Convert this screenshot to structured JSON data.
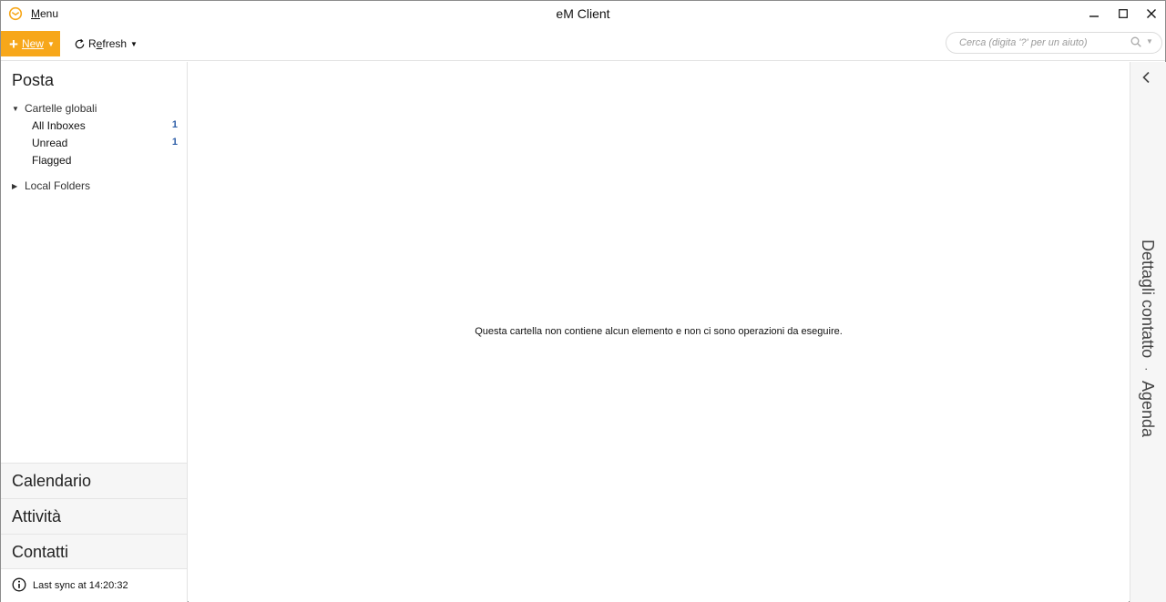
{
  "titlebar": {
    "menu_label_prefix": "",
    "menu_label_underlined": "M",
    "menu_label_rest": "enu",
    "window_title": "eM Client",
    "icons": {
      "app": "envelope-logo-icon",
      "minimize": "minimize-icon",
      "maximize": "maximize-icon",
      "close": "close-icon"
    }
  },
  "toolbar": {
    "new_label_underlined": "N",
    "new_label_rest": "ew",
    "refresh_label_prefix": "R",
    "refresh_label_underlined": "e",
    "refresh_label_rest": "fresh",
    "search_placeholder": "Cerca (digita '?' per un aiuto)",
    "accent_color": "#f7a71a"
  },
  "sidebar": {
    "title": "Posta",
    "global_folders": {
      "label": "Cartelle globali",
      "expanded": true,
      "items": [
        {
          "label": "All Inboxes",
          "count": "1"
        },
        {
          "label": "Unread",
          "count": "1"
        },
        {
          "label": "Flagged",
          "count": ""
        }
      ]
    },
    "local_folders": {
      "label": "Local Folders",
      "expanded": false
    },
    "sections": [
      {
        "label": "Calendario"
      },
      {
        "label": "Attività"
      },
      {
        "label": "Contatti"
      }
    ],
    "sync_status": "Last sync at 14:20:32"
  },
  "main": {
    "empty_message": "Questa cartella non contiene alcun elemento e non ci sono operazioni da eseguire."
  },
  "right_panel": {
    "tabs": [
      {
        "label": "Dettagli contatto"
      },
      {
        "label": "Agenda"
      }
    ],
    "separator": "·"
  }
}
